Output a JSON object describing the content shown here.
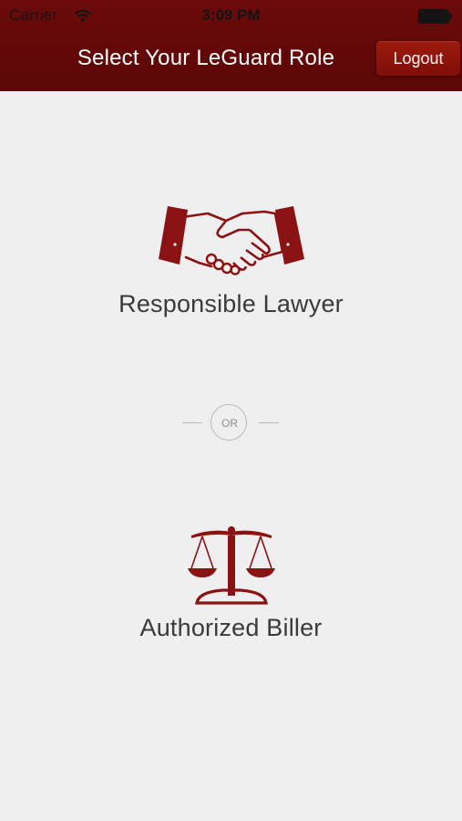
{
  "status_bar": {
    "carrier": "Carrier",
    "time": "3:09 PM",
    "wifi_icon": "wifi-icon",
    "battery_icon": "battery-icon"
  },
  "nav": {
    "title": "Select Your LeGuard Role",
    "logout_label": "Logout"
  },
  "roles": [
    {
      "label": "Responsible Lawyer",
      "icon": "handshake-icon"
    },
    {
      "label": "Authorized Biller",
      "icon": "scales-icon"
    }
  ],
  "divider": {
    "label": "OR"
  },
  "colors": {
    "brand": "#6b0a0a",
    "button": "#8e1209",
    "icon": "#8b1212",
    "background": "#efefef",
    "label_text": "#3a3a3a"
  }
}
